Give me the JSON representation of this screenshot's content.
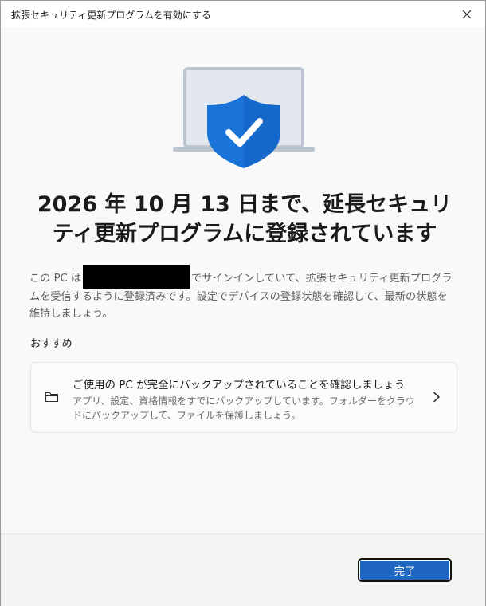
{
  "window": {
    "title": "拡張セキュリティ更新プログラムを有効にする"
  },
  "main": {
    "heading": "2026 年 10 月 13 日まで、延長セキュリティ更新プログラムに登録されています",
    "body_before_redaction": "この PC は",
    "body_after_redaction": "でサインインしていて、拡張セキュリティ更新プログラムを受信するように登録済みです。設定でデバイスの登録状態を確認して、最新の状態を維持しましょう。",
    "section_label": "おすすめ",
    "recommendation": {
      "title": "ご使用の PC が完全にバックアップされていることを確認しましょう",
      "description": "アプリ、設定、資格情報をすでにバックアップしています。フォルダーをクラウドにバックアップして、ファイルを保護しましょう。",
      "icon": "folder-icon"
    }
  },
  "footer": {
    "done_label": "完了"
  },
  "colors": {
    "accent": "#1f66c1",
    "shield": "#1a73d9",
    "laptop_frame": "#bcc5d0"
  }
}
